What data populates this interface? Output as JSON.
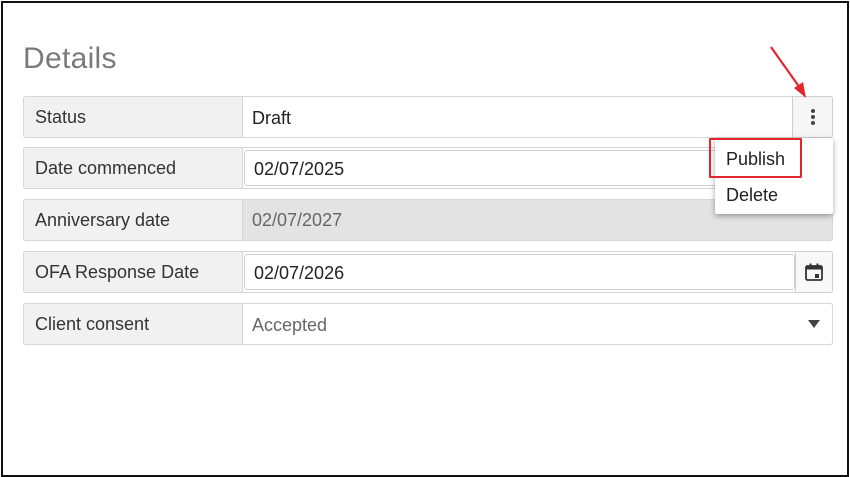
{
  "page": {
    "title": "Details"
  },
  "fields": [
    {
      "label": "Status",
      "value": "Draft"
    },
    {
      "label": "Date commenced",
      "value": "02/07/2025"
    },
    {
      "label": "Anniversary date",
      "value": "02/07/2027"
    },
    {
      "label": "OFA Response Date",
      "value": "02/07/2026"
    },
    {
      "label": "Client consent",
      "value": "Accepted"
    }
  ],
  "status_menu": {
    "items": [
      {
        "label": "Publish",
        "highlighted": true
      },
      {
        "label": "Delete",
        "highlighted": false
      }
    ]
  },
  "icons": {
    "menu_button": "more-vertical-icon",
    "calendar_button": "calendar-icon",
    "dropdown": "chevron-down-icon",
    "annotation": "red-arrow"
  },
  "colors": {
    "highlight": "#e3262e",
    "label_bg": "#f1f1f1",
    "disabled_bg": "#e3e3e3",
    "title": "#7a7a7a"
  }
}
